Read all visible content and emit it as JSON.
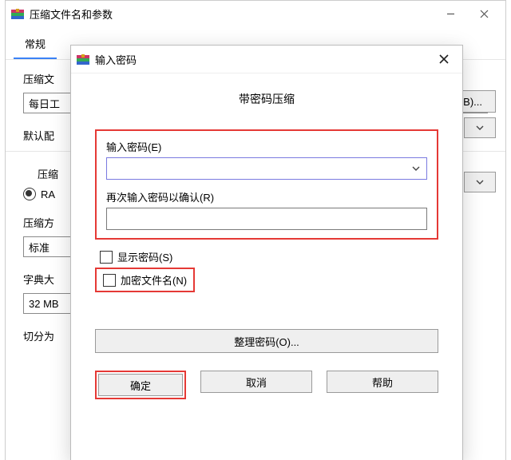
{
  "parent": {
    "title": "压缩文件名和参数",
    "tab_general": "常规",
    "fields": {
      "archive_label": "压缩文",
      "archive_value": "每日工",
      "default_label": "默认配",
      "method_group": "压缩",
      "format_rar": "RA",
      "compress_label": "压缩方",
      "compress_value": "标准",
      "dict_label": "字典大",
      "dict_value": "32 MB",
      "split_label": "切分为"
    },
    "browse": "(B)..."
  },
  "modal": {
    "title": "输入密码",
    "heading": "带密码压缩",
    "enter_pw": "输入密码(E)",
    "reenter_pw": "再次输入密码以确认(R)",
    "show_pw": "显示密码(S)",
    "encrypt_names": "加密文件名(N)",
    "organize": "整理密码(O)...",
    "ok": "确定",
    "cancel": "取消",
    "help": "帮助"
  }
}
